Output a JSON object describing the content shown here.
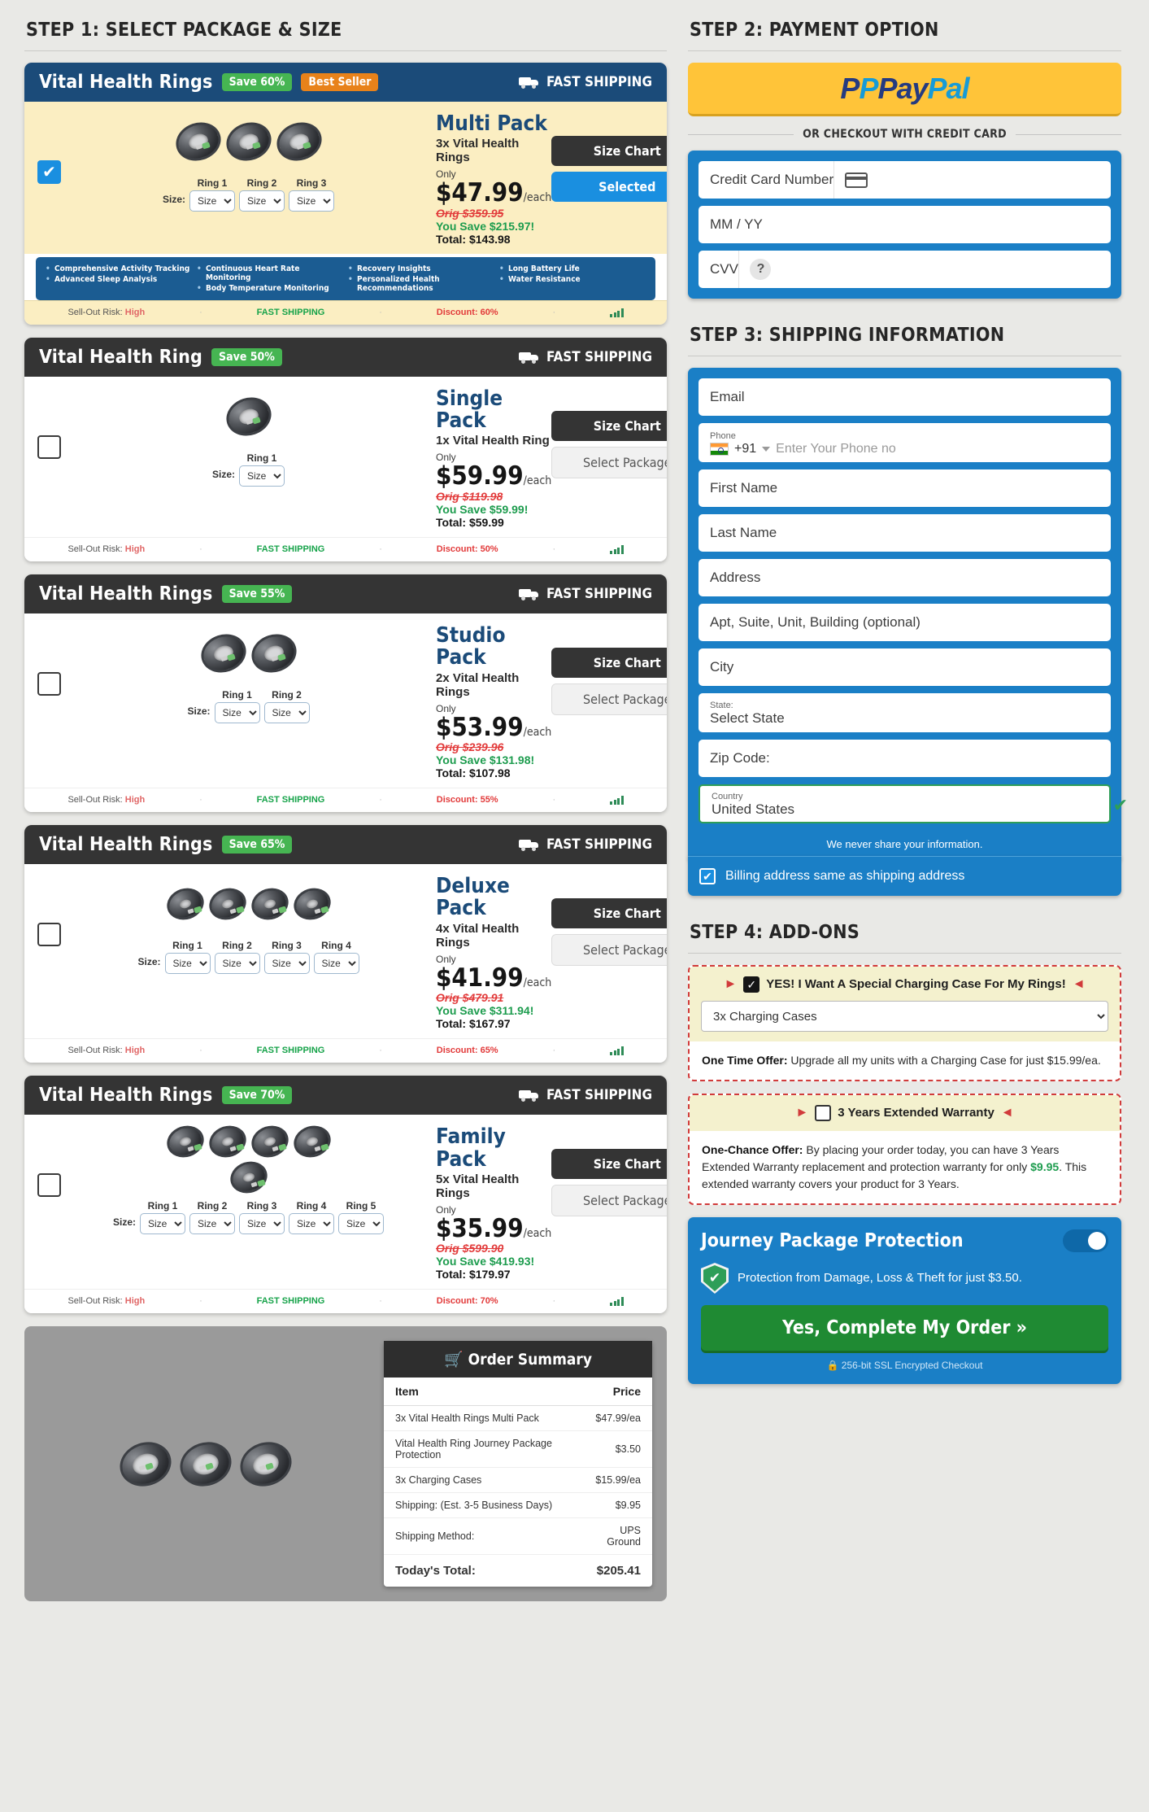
{
  "steps": {
    "step1": "STEP 1: SELECT PACKAGE & SIZE",
    "step2": "STEP 2: PAYMENT OPTION",
    "step3": "STEP 3: SHIPPING INFORMATION",
    "step4": "STEP 4: ADD-ONS"
  },
  "common": {
    "fast_shipping": "FAST SHIPPING",
    "size_label": "Size:",
    "size_option": "Size",
    "only_label": "Only",
    "each_suffix": "/each",
    "size_chart_label": "Size Chart",
    "selected_label": "Selected",
    "select_package_label": "Select Package",
    "sellout_label": "Sell-Out Risk:",
    "sellout_value": "High",
    "dot": "·"
  },
  "features": [
    [
      "Comprehensive Activity Tracking",
      "Advanced Sleep Analysis"
    ],
    [
      "Continuous Heart Rate Monitoring",
      "Body Temperature Monitoring"
    ],
    [
      "Recovery Insights",
      "Personalized Health Recommendations"
    ],
    [
      "Long Battery Life",
      "Water Resistance"
    ]
  ],
  "packages": [
    {
      "header_title": "Vital Health Rings",
      "save_badge": "Save 60%",
      "best_seller": "Best Seller",
      "name": "Multi Pack",
      "subtitle": "3x Vital Health Rings",
      "price": "$47.99",
      "orig": "Orig $359.95",
      "save": "You Save $215.97!",
      "total": "Total: $143.98",
      "ring_labels": [
        "Ring 1",
        "Ring 2",
        "Ring 3"
      ],
      "discount": "Discount: 60%",
      "selected": true
    },
    {
      "header_title": "Vital Health Ring",
      "save_badge": "Save 50%",
      "name": "Single Pack",
      "subtitle": "1x Vital Health Ring",
      "price": "$59.99",
      "orig": "Orig $119.98",
      "save": "You Save $59.99!",
      "total": "Total: $59.99",
      "ring_labels": [
        "Ring 1"
      ],
      "discount": "Discount: 50%",
      "selected": false
    },
    {
      "header_title": "Vital Health Rings",
      "save_badge": "Save 55%",
      "name": "Studio Pack",
      "subtitle": "2x Vital Health Rings",
      "price": "$53.99",
      "orig": "Orig $239.96",
      "save": "You Save $131.98!",
      "total": "Total: $107.98",
      "ring_labels": [
        "Ring 1",
        "Ring 2"
      ],
      "discount": "Discount: 55%",
      "selected": false
    },
    {
      "header_title": "Vital Health Rings",
      "save_badge": "Save 65%",
      "name": "Deluxe Pack",
      "subtitle": "4x Vital Health Rings",
      "price": "$41.99",
      "orig": "Orig $479.91",
      "save": "You Save $311.94!",
      "total": "Total: $167.97",
      "ring_labels": [
        "Ring 1",
        "Ring 2",
        "Ring 3",
        "Ring 4"
      ],
      "discount": "Discount: 65%",
      "selected": false
    },
    {
      "header_title": "Vital Health Rings",
      "save_badge": "Save 70%",
      "name": "Family Pack",
      "subtitle": "5x Vital Health Rings",
      "price": "$35.99",
      "orig": "Orig $599.90",
      "save": "You Save $419.93!",
      "total": "Total: $179.97",
      "ring_labels": [
        "Ring 1",
        "Ring 2",
        "Ring 3",
        "Ring 4",
        "Ring 5"
      ],
      "discount": "Discount: 70%",
      "selected": false
    }
  ],
  "order_summary": {
    "title": "Order Summary",
    "col_item": "Item",
    "col_price": "Price",
    "rows": [
      {
        "item": "3x Vital Health Rings Multi Pack",
        "price": "$47.99/ea"
      },
      {
        "item": "Vital Health Ring Journey Package Protection",
        "price": "$3.50"
      },
      {
        "item": "3x Charging Cases",
        "price": "$15.99/ea"
      },
      {
        "item": "Shipping: (Est. 3-5 Business Days)",
        "price": "$9.95"
      },
      {
        "item": "Shipping Method:",
        "price": "UPS Ground"
      }
    ],
    "total_label": "Today's Total:",
    "total_value": "$205.41"
  },
  "payment": {
    "paypal_p": "P",
    "paypal_pay": "Pay",
    "paypal_pal": "Pal",
    "or_text": "OR CHECKOUT WITH CREDIT CARD",
    "card_placeholder": "Credit Card Number",
    "expiry_placeholder": "MM / YY",
    "cvv_placeholder": "CVV",
    "help_glyph": "?"
  },
  "shipping": {
    "email": "Email",
    "phone_label": "Phone",
    "country_code": "+91",
    "phone_placeholder": "Enter Your Phone no",
    "first_name": "First Name",
    "last_name": "Last Name",
    "address": "Address",
    "apt": "Apt, Suite, Unit, Building (optional)",
    "city": "City",
    "state_label": "State:",
    "state_value": "Select State",
    "zip": "Zip Code:",
    "country_label": "Country",
    "country_value": "United States",
    "never_share": "We never share your information.",
    "billing_same": "Billing address same as shipping address",
    "check_glyph": "✔"
  },
  "addons": [
    {
      "title": "YES! I Want A Special Charging Case For My Rings!",
      "checked": true,
      "select_value": "3x Charging Cases",
      "body_lead": "One Time Offer:",
      "body_text": " Upgrade all my units with a Charging Case for just $15.99/ea."
    },
    {
      "title": "3 Years Extended Warranty",
      "checked": false,
      "body_lead": "One-Chance Offer:",
      "body_text_1": " By placing your order today, you can have 3 Years Extended Warranty replacement and protection warranty for only ",
      "body_price": "$9.95",
      "body_text_2": ". This extended warranty covers your product for 3 Years."
    }
  ],
  "protection": {
    "title": "Journey Package Protection",
    "text": "Protection from Damage, Loss & Theft for just $3.50.",
    "cta": "Yes, Complete My Order »",
    "ssl": "🔒 256-bit SSL Encrypted Checkout",
    "shield_glyph": "✔"
  }
}
